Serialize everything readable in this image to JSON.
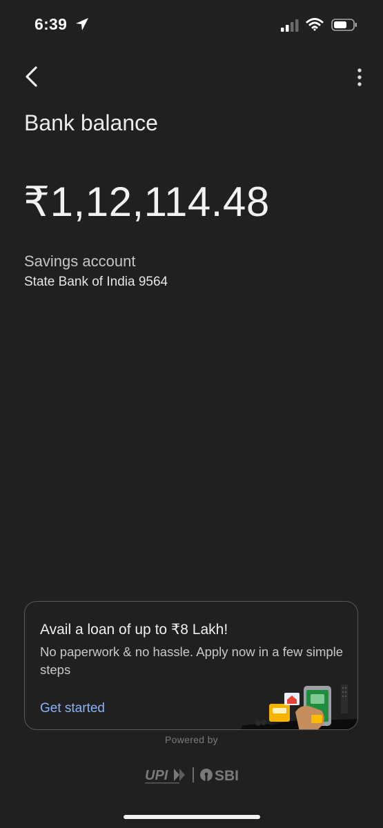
{
  "status_bar": {
    "time": "6:39",
    "icons": [
      "location-arrow-icon",
      "cellular-signal-icon",
      "wifi-icon",
      "battery-icon"
    ]
  },
  "header": {
    "back_icon": "chevron-left-icon",
    "more_icon": "more-vertical-icon"
  },
  "page": {
    "title": "Bank balance",
    "balance": "₹1,12,114.48",
    "account_type": "Savings account",
    "bank_account": "State Bank of India 9564"
  },
  "loan_card": {
    "title": "Avail a loan of up to ₹8 Lakh!",
    "description": "No paperwork & no hassle. Apply now in a few simple steps",
    "cta": "Get started"
  },
  "footer": {
    "powered_by": "Powered by",
    "partner_logos": [
      "UPI",
      "SBI"
    ]
  },
  "colors": {
    "background": "#202020",
    "accent_link": "#8ab4f8",
    "card_border": "#5a5a5a"
  }
}
